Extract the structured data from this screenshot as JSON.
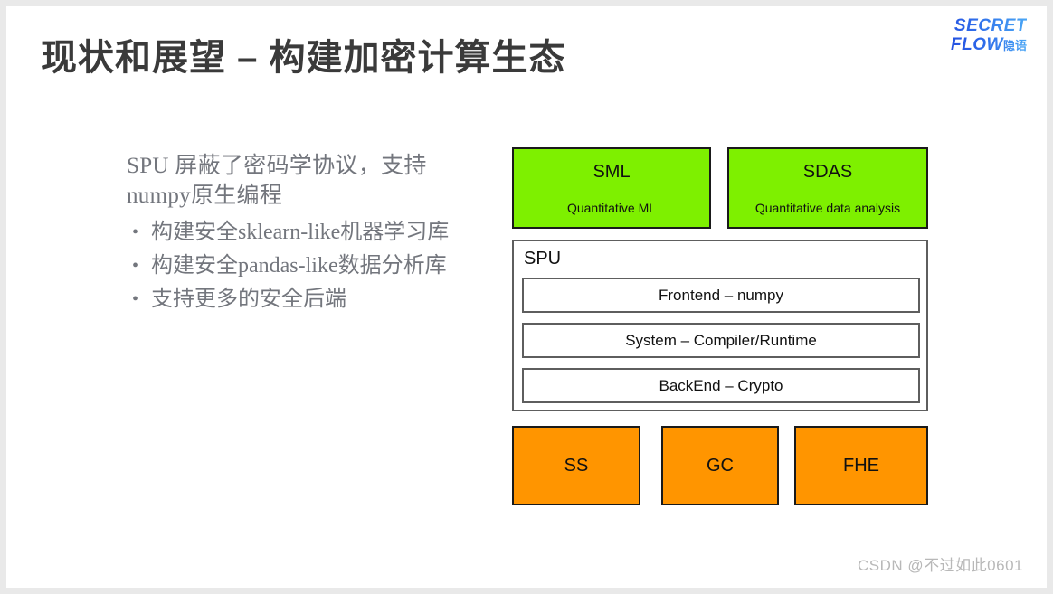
{
  "slide": {
    "title": "现状和展望 – 构建加密计算生态",
    "background_color": "#ffffff",
    "frame_color": "#e9e9e9"
  },
  "logo": {
    "line1": "SECRET",
    "line2": "FLOW",
    "suffix_cn": "隐语",
    "color": "#2a63e8"
  },
  "left_column": {
    "intro": "SPU  屏蔽了密码学协议，支持numpy原生编程",
    "bullet_marker": "•",
    "bullets": [
      "构建安全sklearn-like机器学习库",
      "构建安全pandas-like数据分析库",
      "支持更多的安全后端"
    ],
    "text_color": "#73767d"
  },
  "diagram": {
    "green_color": "#7ef000",
    "orange_color": "#ff9500",
    "border_color": "#1a1a1a",
    "app_layer": [
      {
        "title": "SML",
        "subtitle": "Quantitative ML"
      },
      {
        "title": "SDAS",
        "subtitle": "Quantitative data analysis"
      }
    ],
    "spu": {
      "label": "SPU",
      "layers": [
        "Frontend – numpy",
        "System – Compiler/Runtime",
        "BackEnd – Crypto"
      ]
    },
    "backend_layer": [
      {
        "title": "SS"
      },
      {
        "title": "GC"
      },
      {
        "title": "FHE"
      }
    ]
  },
  "watermark": "CSDN @不过如此0601"
}
